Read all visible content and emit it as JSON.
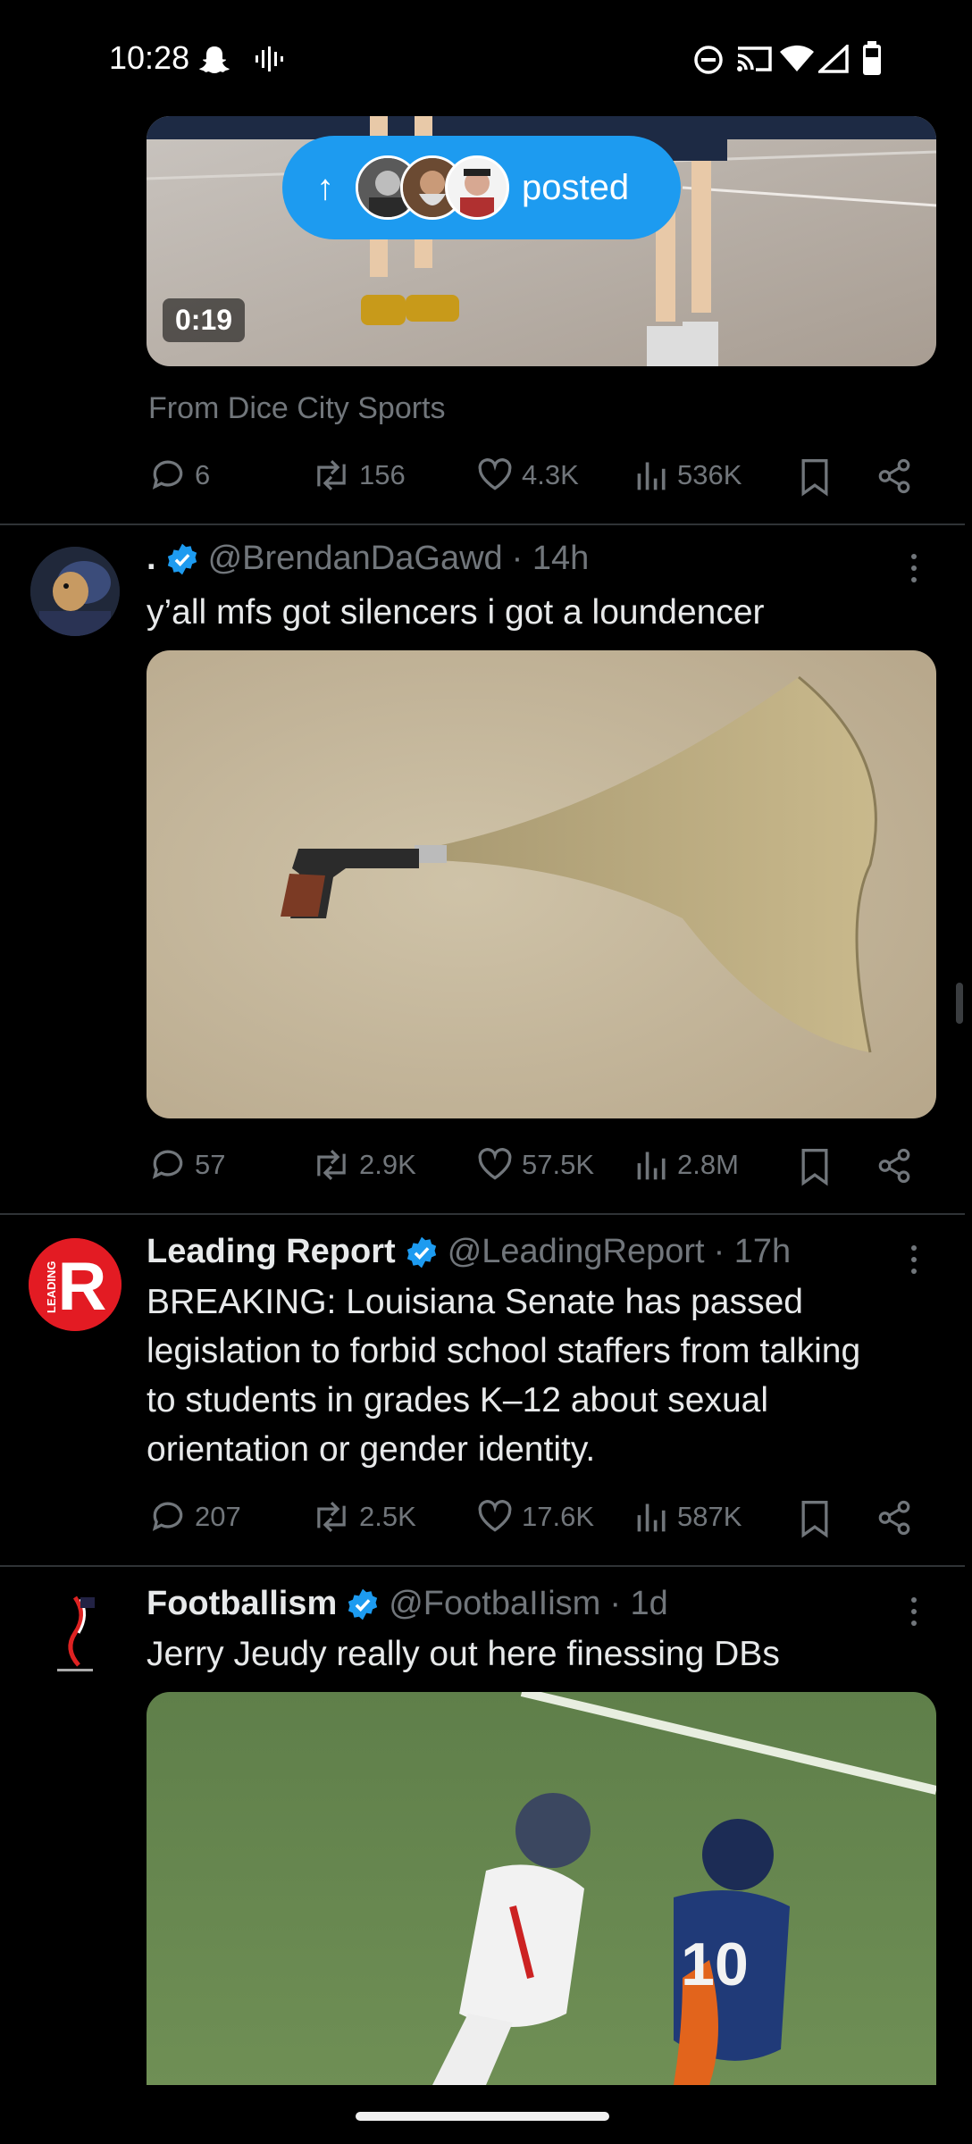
{
  "status_bar": {
    "time": "10:28",
    "icons": [
      "snapchat-icon",
      "voice-icon",
      "dnd-icon",
      "cast-icon",
      "wifi-icon",
      "signal-icon",
      "battery-icon"
    ]
  },
  "posted_pill": {
    "arrow": "↑",
    "label": "posted"
  },
  "tweets": [
    {
      "id": "dice",
      "video_duration": "0:19",
      "source": "From Dice City Sports",
      "stats": {
        "replies": "6",
        "reposts": "156",
        "likes": "4.3K",
        "views": "536K"
      }
    },
    {
      "id": "brendan",
      "name": ".",
      "handle": "@BrendanDaGawd",
      "time": "· 14h",
      "text": "y’all mfs got silencers i got a loundencer",
      "stats": {
        "replies": "57",
        "reposts": "2.9K",
        "likes": "57.5K",
        "views": "2.8M"
      }
    },
    {
      "id": "leading",
      "name": "Leading Report",
      "handle": "@LeadingReport",
      "time": "· 17h",
      "text": "BREAKING: Louisiana Senate has passed legislation to forbid school staffers from talking to students in grades K–12 about sexual orientation or gender identity.",
      "stats": {
        "replies": "207",
        "reposts": "2.5K",
        "likes": "17.6K",
        "views": "587K"
      }
    },
    {
      "id": "footballism",
      "name": "Footballism",
      "handle": "@FootbaIIism",
      "time": "· 1d",
      "text": "Jerry Jeudy really out here finessing DBs",
      "jersey_number": "10"
    }
  ],
  "logos": {
    "leading_letter": "R",
    "leading_word": "LEADING"
  },
  "colors": {
    "background": "#000000",
    "accent": "#1d9bf0",
    "muted": "#71767b",
    "divider": "#2f3336",
    "leading_red": "#e31b23"
  }
}
